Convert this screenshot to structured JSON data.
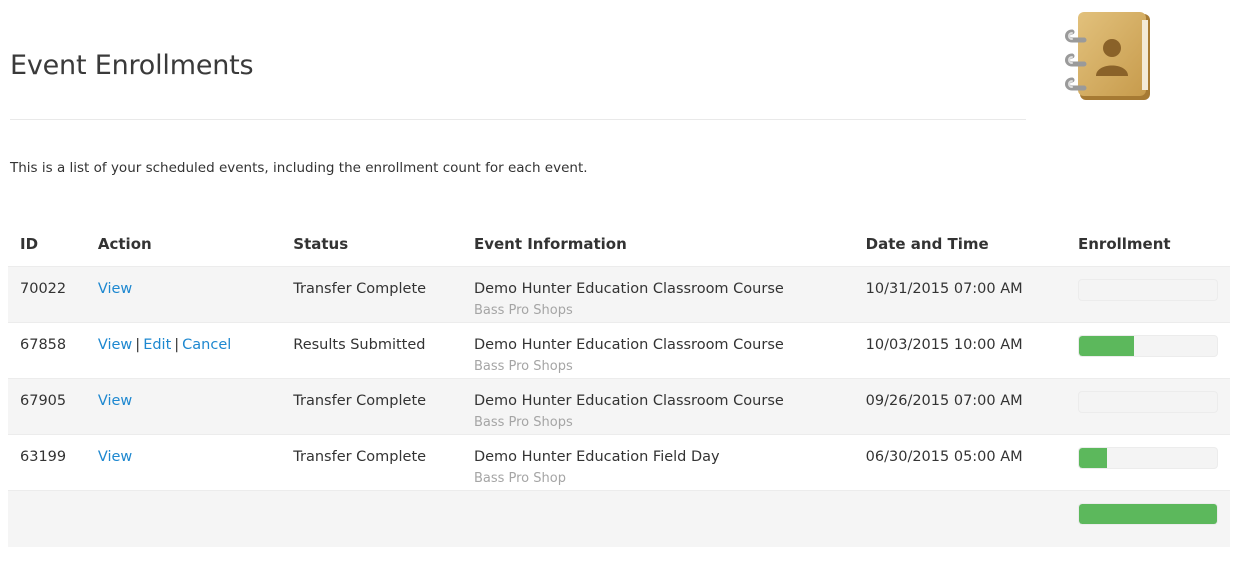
{
  "page": {
    "title": "Event Enrollments",
    "intro": "This is a list of your scheduled events, including the enrollment count for each event.",
    "icon": "address-book-icon"
  },
  "table": {
    "headers": {
      "id": "ID",
      "action": "Action",
      "status": "Status",
      "event": "Event Information",
      "date": "Date and Time",
      "enrollment": "Enrollment"
    },
    "rows": [
      {
        "id": "70022",
        "actions": [
          "View"
        ],
        "status": "Transfer Complete",
        "event_name": "Demo Hunter Education Classroom Course",
        "event_location": "Bass Pro Shops",
        "datetime": "10/31/2015 07:00 AM",
        "enrollment_fraction": 0.0
      },
      {
        "id": "67858",
        "actions": [
          "View",
          "Edit",
          "Cancel"
        ],
        "status": "Results Submitted",
        "event_name": "Demo Hunter Education Classroom Course",
        "event_location": "Bass Pro Shops",
        "datetime": "10/03/2015 10:00 AM",
        "enrollment_fraction": 0.4
      },
      {
        "id": "67905",
        "actions": [
          "View"
        ],
        "status": "Transfer Complete",
        "event_name": "Demo Hunter Education Classroom Course",
        "event_location": "Bass Pro Shops",
        "datetime": "09/26/2015 07:00 AM",
        "enrollment_fraction": 0.0
      },
      {
        "id": "63199",
        "actions": [
          "View"
        ],
        "status": "Transfer Complete",
        "event_name": "Demo Hunter Education Field Day",
        "event_location": "Bass Pro Shop",
        "datetime": "06/30/2015 05:00 AM",
        "enrollment_fraction": 0.2
      }
    ],
    "partial_row_enrollment_fraction": 1.0
  },
  "colors": {
    "link": "#1e88d0",
    "progress": "#5cb85c",
    "stripe": "#f5f5f5"
  }
}
